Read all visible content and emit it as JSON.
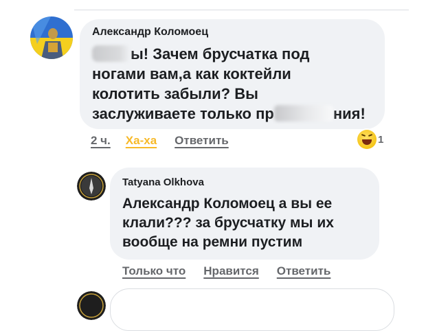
{
  "comments": [
    {
      "author": "Александр Коломоец",
      "text_lines": [
        "ы! Зачем брусчатка под",
        "ногами вам,а как коктейли",
        "колотить забыли? Вы",
        "заслуживаете только пр"
      ],
      "text_tail": "ния!",
      "actions": {
        "time": "2 ч.",
        "reaction_label": "Ха-ха",
        "reply": "Ответить"
      },
      "reaction": {
        "icon": "laugh-emoji-icon",
        "count": "1"
      },
      "reaction_color": "#f7b928"
    },
    {
      "author": "Tatyana Olkhova",
      "text_lines": [
        "Александр Коломоец а вы ее",
        "клали??? за брусчатку мы их",
        "вообще на ремни пустим"
      ],
      "actions": {
        "time": "Только что",
        "like": "Нравится",
        "reply": "Ответить"
      }
    }
  ],
  "colors": {
    "action_text": "#65676b",
    "bubble": "#f0f2f5"
  }
}
